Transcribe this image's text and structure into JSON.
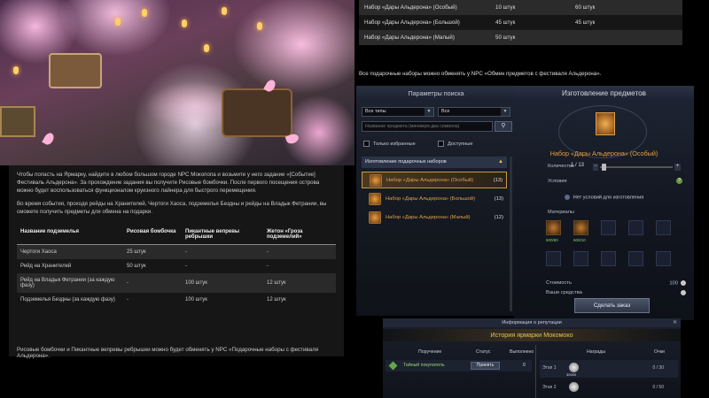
{
  "hero": {
    "alt": "Ярмарка Мокомоко"
  },
  "article": {
    "paragraph1": "Чтобы попасть на Ярмарку, найдите в любом большом городе NPC Мокопопа и возьмите у него задание «[Событие] Фестиваль Альдерона». За прохождение задания вы получите Рисовые бомбочки. После первого посещения острова можно будет воспользоваться функционалом круизного лайнера для быстрого перемещения.",
    "paragraph2": "Во время события, проходя рейды на Хранителей, Чертоги Хаоса, подземелья Бездны и рейды на Владык Фетрании, вы сможете получить предметы для обмена на подарки.",
    "table": {
      "headers": [
        "Название подземелья",
        "Рисовая бомбочка",
        "Пикантные вепревы ребрышки",
        "Жетон «Гроза подземелий»"
      ],
      "rows": [
        [
          "Чертоги Хаоса",
          "25 штук",
          "-",
          "-"
        ],
        [
          "Рейд на Хранителей",
          "50 штук",
          "-",
          "-"
        ],
        [
          "Рейд на Владык Фетрании (за каждую фазу)",
          "-",
          "100 штук",
          "12 штук"
        ],
        [
          "Подземелья Бездны (за каждую фазу)",
          "-",
          "100 штук",
          "12 штук"
        ]
      ]
    },
    "footer": "Рисовые бомбочки и Пикантные вепревы ребрышки можно будет обменять у NPC «Подарочные наборы с фестиваля Альдерона»."
  },
  "top_table": {
    "rows": [
      [
        "Набор «Дары Альдерона» (Особый)",
        "10 штук",
        "60 штук"
      ],
      [
        "Набор «Дары Альдерона» (Большой)",
        "45 штук",
        "45 штук"
      ],
      [
        "Набор «Дары Альдерона» (Малый)",
        "50 штук",
        ""
      ]
    ],
    "exchange_note": "Все подарочные наборы можно обменять у NPC «Обмен предметов с фестиваля Альдерона»."
  },
  "search_panel": {
    "title": "Параметры поиска",
    "type_select": "Все типы",
    "second_select": "Все",
    "search_placeholder": "Название предмета (минимум два символа)",
    "search_icon": "search-icon",
    "only_favorites": "Только избранные",
    "available": "Доступные",
    "category": "Изготовление подарочных наборов",
    "recipes": [
      {
        "name": "Набор «Дары Альдерона» (Особый)",
        "count": "(13)"
      },
      {
        "name": "Набор «Дары Альдерона» (Большой)",
        "count": "(13)"
      },
      {
        "name": "Набор «Дары Альдерона» (Малый)",
        "count": "(12)"
      }
    ]
  },
  "craft_panel": {
    "title": "Изготовление предметов",
    "item_name": "Набор «Дары Альдерона» (Особый)",
    "quantity_label": "Количество",
    "quantity_value": "1 / 13",
    "conditions_label": "Условия",
    "no_conditions": "Нет условий для изготовления",
    "materials_label": "Материалы",
    "materials": [
      {
        "amount": "600/60"
      },
      {
        "amount": "600/10"
      }
    ],
    "cost_label": "Стоимость",
    "cost_value": "100",
    "my_funds_label": "Ваши средства",
    "order_button": "Сделать заказ"
  },
  "reputation": {
    "header": "Информация о репутации",
    "title": "История ярмарки Мокомоко",
    "columns": {
      "task": "Поручение",
      "status": "Статус",
      "done": "Выполнено",
      "rewards": "Награды",
      "points": "Очки"
    },
    "task": {
      "name": "Тайный покупатель",
      "accept": "Принять",
      "done": "0"
    },
    "stages": [
      {
        "name": "Этап 1",
        "amount": "30000",
        "score": "0 / 30"
      },
      {
        "name": "Этап 2",
        "amount": "",
        "score": "0 / 50"
      }
    ]
  },
  "colors": {
    "accent_orange": "#e8a040",
    "gold": "#e6c060",
    "panel_bg": "#161616"
  }
}
